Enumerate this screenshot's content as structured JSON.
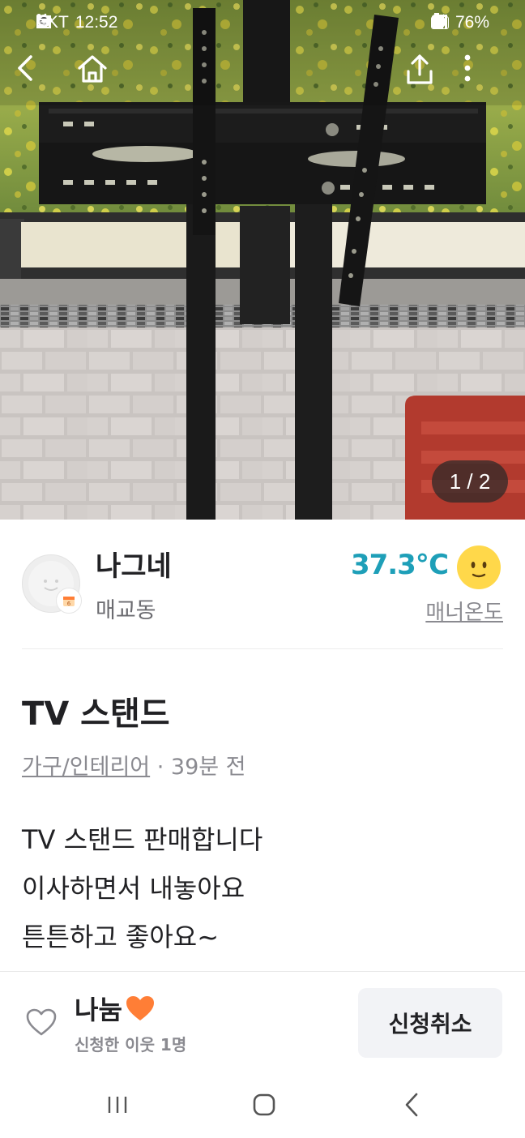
{
  "status_bar": {
    "carrier": "SKT",
    "time": "12:52",
    "battery": "76%",
    "network": "5G"
  },
  "image_pager": {
    "text": "1 / 2"
  },
  "seller": {
    "nickname": "나그네",
    "region": "매교동",
    "temperature": "37.3℃",
    "manner_label": "매너온도"
  },
  "post": {
    "title": "TV 스탠드",
    "category": "가구/인테리어",
    "time_ago": " · 39분 전",
    "body_lines": [
      "TV 스탠드 판매합니다",
      "이사하면서 내놓아요",
      "튼튼하고 좋아요~"
    ]
  },
  "bottom_bar": {
    "price_label": "나눔",
    "applicants": "신청한 이웃 1명",
    "cancel_button": "신청취소"
  },
  "icons": {
    "back": "back-arrow-icon",
    "home": "home-icon",
    "share": "share-icon",
    "more": "more-vertical-icon",
    "heart": "heart-outline-icon",
    "heart_emoji": "orange-heart-icon",
    "temperature_face": "smiley-face-icon"
  },
  "colors": {
    "temperature": "#1e9fb8",
    "cancel_bg": "#f2f3f6",
    "heart_emoji": "#ff7e36"
  }
}
